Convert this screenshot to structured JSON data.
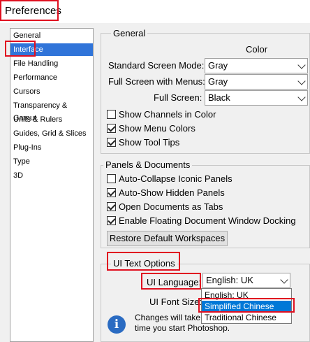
{
  "window": {
    "title": "Preferences"
  },
  "sidebar": {
    "items": [
      {
        "label": "General"
      },
      {
        "label": "Interface"
      },
      {
        "label": "File Handling"
      },
      {
        "label": "Performance"
      },
      {
        "label": "Cursors"
      },
      {
        "label": "Transparency & Gamut"
      },
      {
        "label": "Units & Rulers"
      },
      {
        "label": "Guides, Grid & Slices"
      },
      {
        "label": "Plug-Ins"
      },
      {
        "label": "Type"
      },
      {
        "label": "3D"
      }
    ],
    "selected": "Interface"
  },
  "general": {
    "legend": "General",
    "color_header": "Color",
    "standard_label": "Standard Screen Mode:",
    "standard_value": "Gray",
    "menus_label": "Full Screen with Menus:",
    "menus_value": "Gray",
    "fullscreen_label": "Full Screen:",
    "fullscreen_value": "Black",
    "show_channels": {
      "label": "Show Channels in Color",
      "checked": false
    },
    "show_menu_colors": {
      "label": "Show Menu Colors",
      "checked": true
    },
    "show_tool_tips": {
      "label": "Show Tool Tips",
      "checked": true
    }
  },
  "panels": {
    "legend": "Panels & Documents",
    "auto_collapse": {
      "label": "Auto-Collapse Iconic Panels",
      "checked": false
    },
    "auto_show": {
      "label": "Auto-Show Hidden Panels",
      "checked": true
    },
    "open_tabs": {
      "label": "Open Documents as Tabs",
      "checked": true
    },
    "floating_docking": {
      "label": "Enable Floating Document Window Docking",
      "checked": true
    },
    "restore_button": "Restore Default Workspaces"
  },
  "ui_text": {
    "legend": "UI Text Options",
    "language_label": "UI Language:",
    "language_value": "English: UK",
    "language_options": [
      "English: UK",
      "Simplified Chinese",
      "Traditional Chinese"
    ],
    "highlighted_option": "Simplified Chinese",
    "font_size_label": "UI Font Size:",
    "note_line1": "Changes will take",
    "note_line2": "time you start Photoshop."
  },
  "colors": {
    "selection": "#3074d9",
    "annotation": "#e01020",
    "info_icon": "#2a6bc2"
  }
}
